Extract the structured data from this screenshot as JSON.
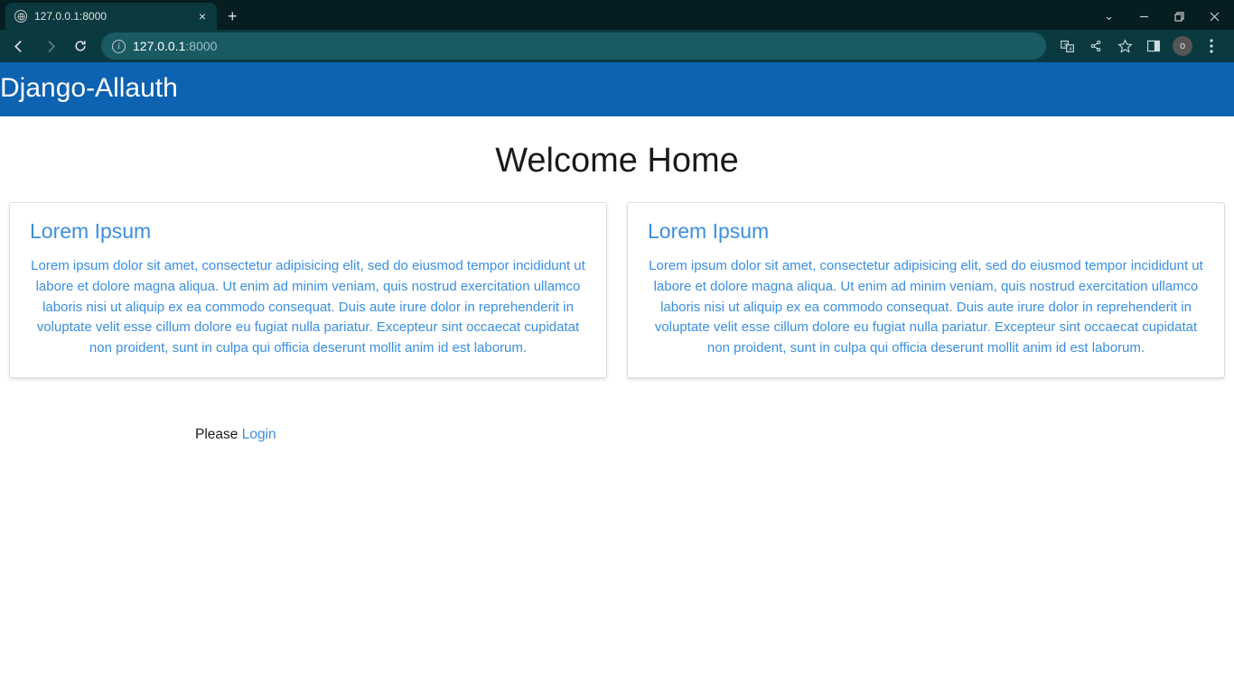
{
  "browser": {
    "tab_title": "127.0.0.1:8000",
    "url_host": "127.0.0.1",
    "url_port": ":8000",
    "profile_badge": "o"
  },
  "page": {
    "navbar_brand": "Django-Allauth",
    "heading": "Welcome Home",
    "cards": [
      {
        "title": "Lorem Ipsum",
        "body": "Lorem ipsum dolor sit amet, consectetur adipisicing elit, sed do eiusmod tempor incididunt ut labore et dolore magna aliqua. Ut enim ad minim veniam, quis nostrud exercitation ullamco laboris nisi ut aliquip ex ea commodo consequat. Duis aute irure dolor in reprehenderit in voluptate velit esse cillum dolore eu fugiat nulla pariatur. Excepteur sint occaecat cupidatat non proident, sunt in culpa qui officia deserunt mollit anim id est laborum."
      },
      {
        "title": "Lorem Ipsum",
        "body": "Lorem ipsum dolor sit amet, consectetur adipisicing elit, sed do eiusmod tempor incididunt ut labore et consequat. Duis aute irure dolor in reprehenderit in voluptate velit esse cillum dolore eu fugiat nulla pariatur. Excepteur sint occaecat cupidatat non proident, sunt in culpa qui officia deserunt mollit anim id est laborum."
      }
    ],
    "login_prompt_prefix": "Please ",
    "login_link_text": "Login"
  }
}
